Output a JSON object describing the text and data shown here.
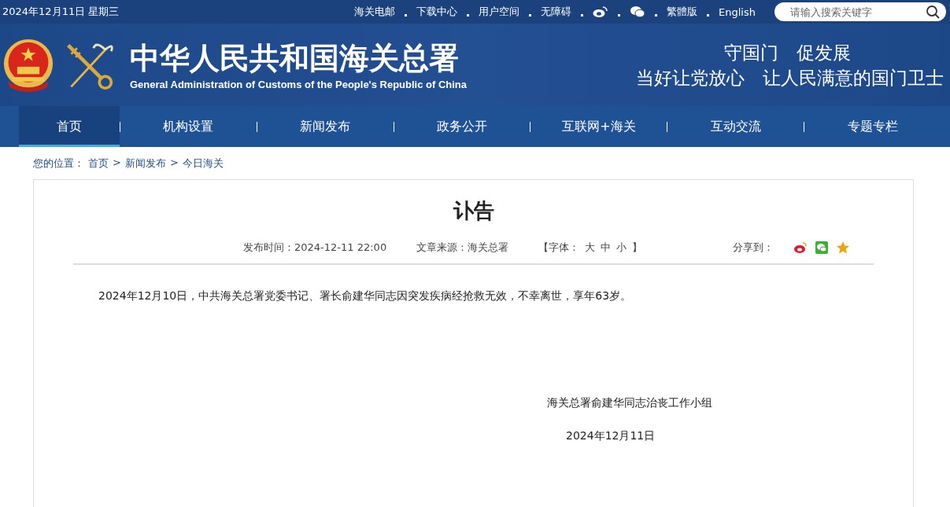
{
  "top_bar": {
    "date": "2024年12月11日 星期三",
    "links": [
      {
        "kind": "text",
        "label": "海关电邮"
      },
      {
        "kind": "text",
        "label": "下载中心"
      },
      {
        "kind": "text",
        "label": "用户空间"
      },
      {
        "kind": "text",
        "label": "无障碍"
      },
      {
        "kind": "weibo"
      },
      {
        "kind": "wechat"
      },
      {
        "kind": "text",
        "label": "繁體版"
      },
      {
        "kind": "text",
        "label": "English"
      }
    ],
    "search": {
      "placeholder": "请输入搜索关键字"
    }
  },
  "header": {
    "title": "中华人民共和国海关总署",
    "subtitle": "General Administration of Customs of the People's Republic of China",
    "slogans": [
      "守国门　促发展",
      "当好让党放心　让人民满意的国门卫士"
    ]
  },
  "nav": [
    {
      "label": "首页",
      "selected": true
    },
    {
      "label": "机构设置",
      "selected": false
    },
    {
      "label": "新闻发布",
      "selected": false
    },
    {
      "label": "政务公开",
      "selected": false
    },
    {
      "label": "互联网+海关",
      "selected": false
    },
    {
      "label": "互动交流",
      "selected": false
    },
    {
      "label": "专题专栏",
      "selected": false
    }
  ],
  "breadcrumb": {
    "label": "您的位置：",
    "separator": ">",
    "items": [
      "首页",
      "新闻发布",
      "今日海关"
    ]
  },
  "article": {
    "title": "讣告",
    "meta": {
      "publish_label": "发布时间：",
      "publish_time": "2024-12-11 22:00",
      "source_label": "文章来源：",
      "source": "海关总署",
      "font_open": "【字体：",
      "font_sizes": [
        "大",
        "中",
        "小"
      ],
      "font_close": "】",
      "share_label": "分享到："
    },
    "body": "2024年12月10日，中共海关总署党委书记、署长俞建华同志因突发疾病经抢救无效，不幸离世，享年63岁。",
    "signature": "海关总署俞建华同志治丧工作小组",
    "date": "2024年12月11日"
  }
}
